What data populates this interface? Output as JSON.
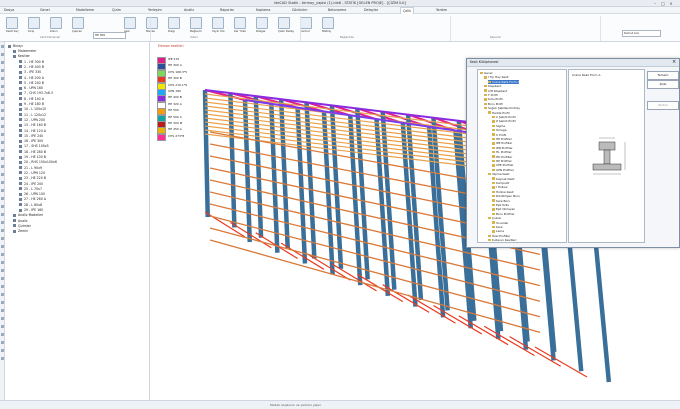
{
  "titlebar": {
    "title": "ideCAD Statik - termoy_yapisi (1).ide8 - STATİK [GELEN PROJE] - [ÇİZİM İLK]"
  },
  "tabs": [
    "Dosya",
    "Genel",
    "Modelleme",
    "Çizim",
    "Yerleşim",
    "Analiz",
    "Raporlar",
    "Kaplama",
    "Görünüm",
    "Betonarme",
    "Detaylar",
    "Çelik",
    "Yardım"
  ],
  "active_tab": "Çelik",
  "search_placeholder": "Komut Ara",
  "ribbon": {
    "items": [
      "Kesit Seç",
      "Kiriş",
      "Kolon",
      "Çapraz",
      "Aşık",
      "Makas",
      "Dizgi",
      "Bağlantı",
      "Yayılı Yük",
      "Kar Yükü",
      "Rüzgar",
      "Çelik Detay",
      "Kontrol",
      "Metraj"
    ],
    "combo_label": "HE 300",
    "groups": [
      "Çelik Elemanlar",
      "Yükler",
      "Bağlantılar",
      "Raporlar"
    ]
  },
  "tree": {
    "root": "Binayı",
    "items": [
      "Malzemeler",
      "Kesitler",
      "1 - HE 300 B",
      "2 - HE 400 B",
      "3 - IPE 330",
      "4 - HE 200 A",
      "5 - HE 240 B",
      "6 - UPN 160",
      "7 - CHS 193.7x6.3",
      "8 - HE 140 A",
      "9 - HE 180 B",
      "10 - L 100x10",
      "11 - L 120x12",
      "12 - UPN 200",
      "13 - HE 160 B",
      "14 - HE 120 A",
      "15 - IPE 240",
      "16 - IPE 300",
      "17 - SHS 100x5",
      "18 - HE 280 B",
      "19 - HE 100 B",
      "20 - RHS 150x100x6",
      "21 - L 90x9",
      "22 - UPN 120",
      "23 - HE 220 B",
      "24 - IPE 200",
      "25 - L 70x7",
      "26 - UPN 100",
      "27 - HE 260 A",
      "28 - L 80x8",
      "29 - IPE 160",
      "Analiz Modelleri",
      "Analiz",
      "Çizimler",
      "Zemin"
    ]
  },
  "viewport": {
    "label": "Eleman kesitleri",
    "legend": [
      {
        "label": "IPE 270",
        "color": "#e0208a"
      },
      {
        "label": "HE 300 A",
        "color": "#2e4f9e"
      },
      {
        "label": "CHS 168.3*5",
        "color": "#7ed957"
      },
      {
        "label": "HE 300 B",
        "color": "#e93a1f"
      },
      {
        "label": "CHS 219.1*6",
        "color": "#f2e600"
      },
      {
        "label": "UPN 180",
        "color": "#1ea7ff"
      },
      {
        "label": "HE 400 B",
        "color": "#8a2be2"
      },
      {
        "label": "HE 320 A",
        "color": "#ffffff"
      },
      {
        "label": "HE 500",
        "color": "#f59e0b"
      },
      {
        "label": "HE 500 A",
        "color": "#0ea5a5"
      },
      {
        "label": "HE 300 M",
        "color": "#b91c1c"
      },
      {
        "label": "HE 450 A",
        "color": "#eab308"
      },
      {
        "label": "CHS 273*8",
        "color": "#ff2d95"
      }
    ]
  },
  "dialog": {
    "title": "Kesit Kütüphanesi",
    "tree_items": [
      "Genel",
      "I Tip Hey Kesit",
      "Crane Rails Form A",
      "Köşebent",
      "Çift Köşebent",
      "T Profil",
      "Kutu Profil",
      "Boru Profil",
      "Soğuk Şekillendirilmiş",
      "Hadde Profil",
      "C Şekilli Profil",
      "Z Şekilli Profil",
      "Sigma",
      "Omega",
      "U Profil",
      "HE Profiller",
      "IPE Profiller",
      "IPN Profiller",
      "HL Profiller",
      "HD Profiller",
      "HP Profiller",
      "UPE Profiller",
      "UPN Profiller",
      "Yapma Kesit",
      "Kaynak Kesit",
      "Kompozit",
      "I Hollow",
      "Hollow Kesit",
      "Dikdörtgen Boru",
      "Kare Boru",
      "Eşit Kollu",
      "Eşit Olmayan",
      "Boru Profiller",
      "Çubuk",
      "Yuvarlak",
      "Kare",
      "Lama",
      "Özel Profiller",
      "Kullanıcı Kesitleri"
    ],
    "preview_title": "Crane Rails Form A",
    "buttons": [
      "Tamam",
      "İptal",
      "Yardım"
    ]
  },
  "statusbar": {
    "text": "Modeli oluşturun ve çizimini yapın"
  }
}
